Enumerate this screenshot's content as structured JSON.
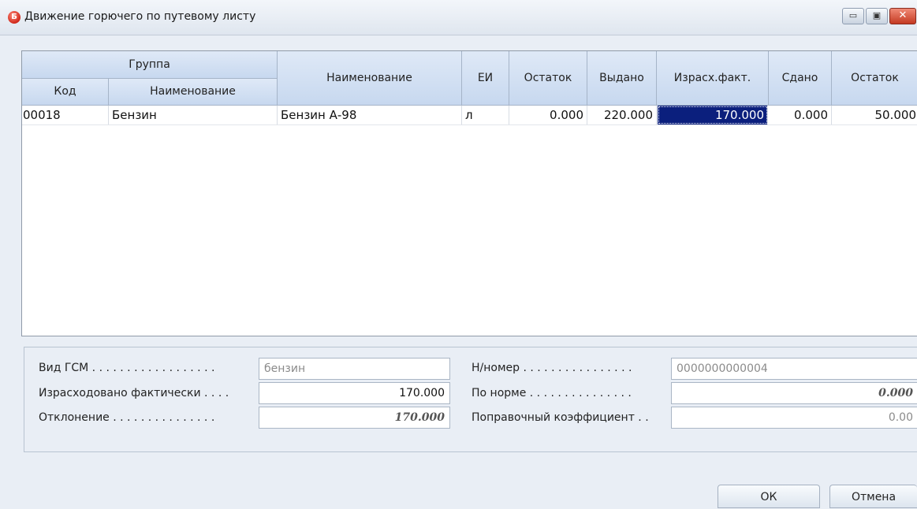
{
  "window": {
    "title": "Движение горючего по путевому листу",
    "app_icon": "Б",
    "min_glyph": "▭",
    "max_glyph": "▣",
    "close_glyph": "✕"
  },
  "grid": {
    "group_header": "Группа",
    "columns": {
      "code": "Код",
      "group_name": "Наименование",
      "name": "Наименование",
      "unit": "ЕИ",
      "rest_start": "Остаток",
      "issued": "Выдано",
      "spent_fact": "Израсх.факт.",
      "returned": "Сдано",
      "rest_end": "Остаток"
    },
    "rows": [
      {
        "code": "00018",
        "group_name": "Бензин",
        "name": "Бензин А-98",
        "unit": "л",
        "rest_start": "0.000",
        "issued": "220.000",
        "spent_fact": "170.000",
        "returned": "0.000",
        "rest_end": "50.000"
      }
    ]
  },
  "form": {
    "fuel_type_label": "Вид ГСМ . . . . . . . . . . . . . . . . . .",
    "fuel_type_value": "бензин",
    "spent_label": "Израсходовано  фактически . . . .",
    "spent_value": "170.000",
    "deviation_label": "Отклонение . . . . . . . . . . . . . . .",
    "deviation_value": "170.000",
    "number_label": "Н/номер . . . . . . . . . . . . . . . .",
    "number_value": "0000000000004",
    "norm_label": "По норме . . . . . . . . . . . . . . .",
    "norm_value": "0.000",
    "coef_label": "Поправочный коэффициент . .",
    "coef_value": "0.00"
  },
  "buttons": {
    "ok": "ОК",
    "cancel": "Отмена"
  }
}
